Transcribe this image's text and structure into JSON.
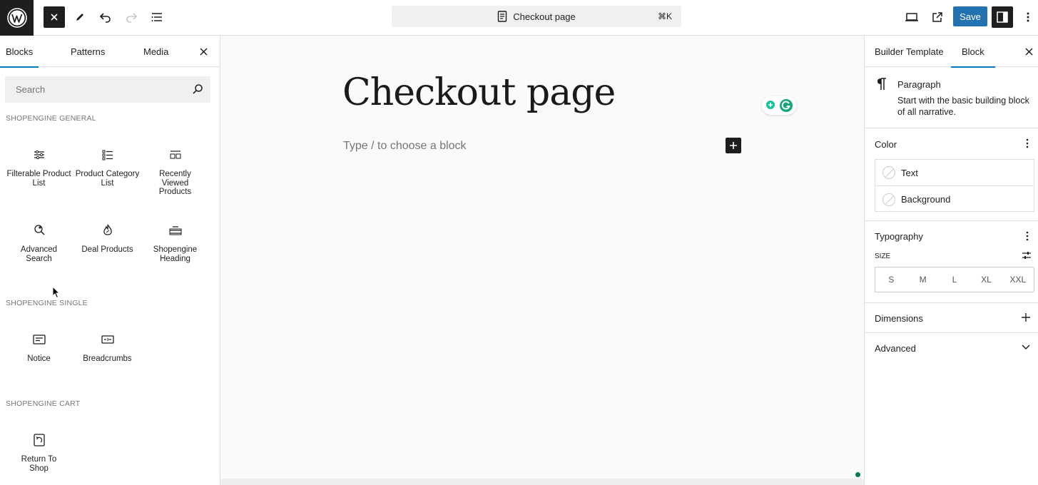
{
  "topbar": {
    "document_title": "Checkout page",
    "shortcut": "⌘K",
    "save_label": "Save"
  },
  "left_panel": {
    "tabs": [
      "Blocks",
      "Patterns",
      "Media"
    ],
    "search_placeholder": "Search",
    "categories": [
      {
        "title": "SHOPENGINE GENERAL",
        "blocks": [
          {
            "label": "Filterable Product List",
            "icon": "filter-list-icon"
          },
          {
            "label": "Product Category List",
            "icon": "category-list-icon"
          },
          {
            "label": "Recently Viewed Products",
            "icon": "recent-products-icon"
          },
          {
            "label": "Advanced Search",
            "icon": "advanced-search-icon"
          },
          {
            "label": "Deal Products",
            "icon": "deal-fire-icon"
          },
          {
            "label": "Shopengine Heading",
            "icon": "heading-icon"
          }
        ]
      },
      {
        "title": "SHOPENGINE SINGLE",
        "blocks": [
          {
            "label": "Notice",
            "icon": "notice-icon"
          },
          {
            "label": "Breadcrumbs",
            "icon": "breadcrumbs-icon"
          }
        ]
      },
      {
        "title": "SHOPENGINE CART",
        "blocks": [
          {
            "label": "Return To Shop",
            "icon": "return-to-shop-icon"
          }
        ]
      }
    ]
  },
  "canvas": {
    "page_title": "Checkout page",
    "placeholder": "Type / to choose a block"
  },
  "right_panel": {
    "tabs": [
      "Builder Template",
      "Block"
    ],
    "block": {
      "name": "Paragraph",
      "description": "Start with the basic building block of all narrative."
    },
    "color": {
      "title": "Color",
      "items": [
        "Text",
        "Background"
      ]
    },
    "typography": {
      "title": "Typography",
      "size_label": "SIZE",
      "sizes": [
        "S",
        "M",
        "L",
        "XL",
        "XXL"
      ]
    },
    "dimensions": {
      "title": "Dimensions"
    },
    "advanced": {
      "title": "Advanced"
    }
  },
  "colors": {
    "accent": "#007cba",
    "save_button": "#2271b1",
    "dark": "#1e1e1e"
  }
}
